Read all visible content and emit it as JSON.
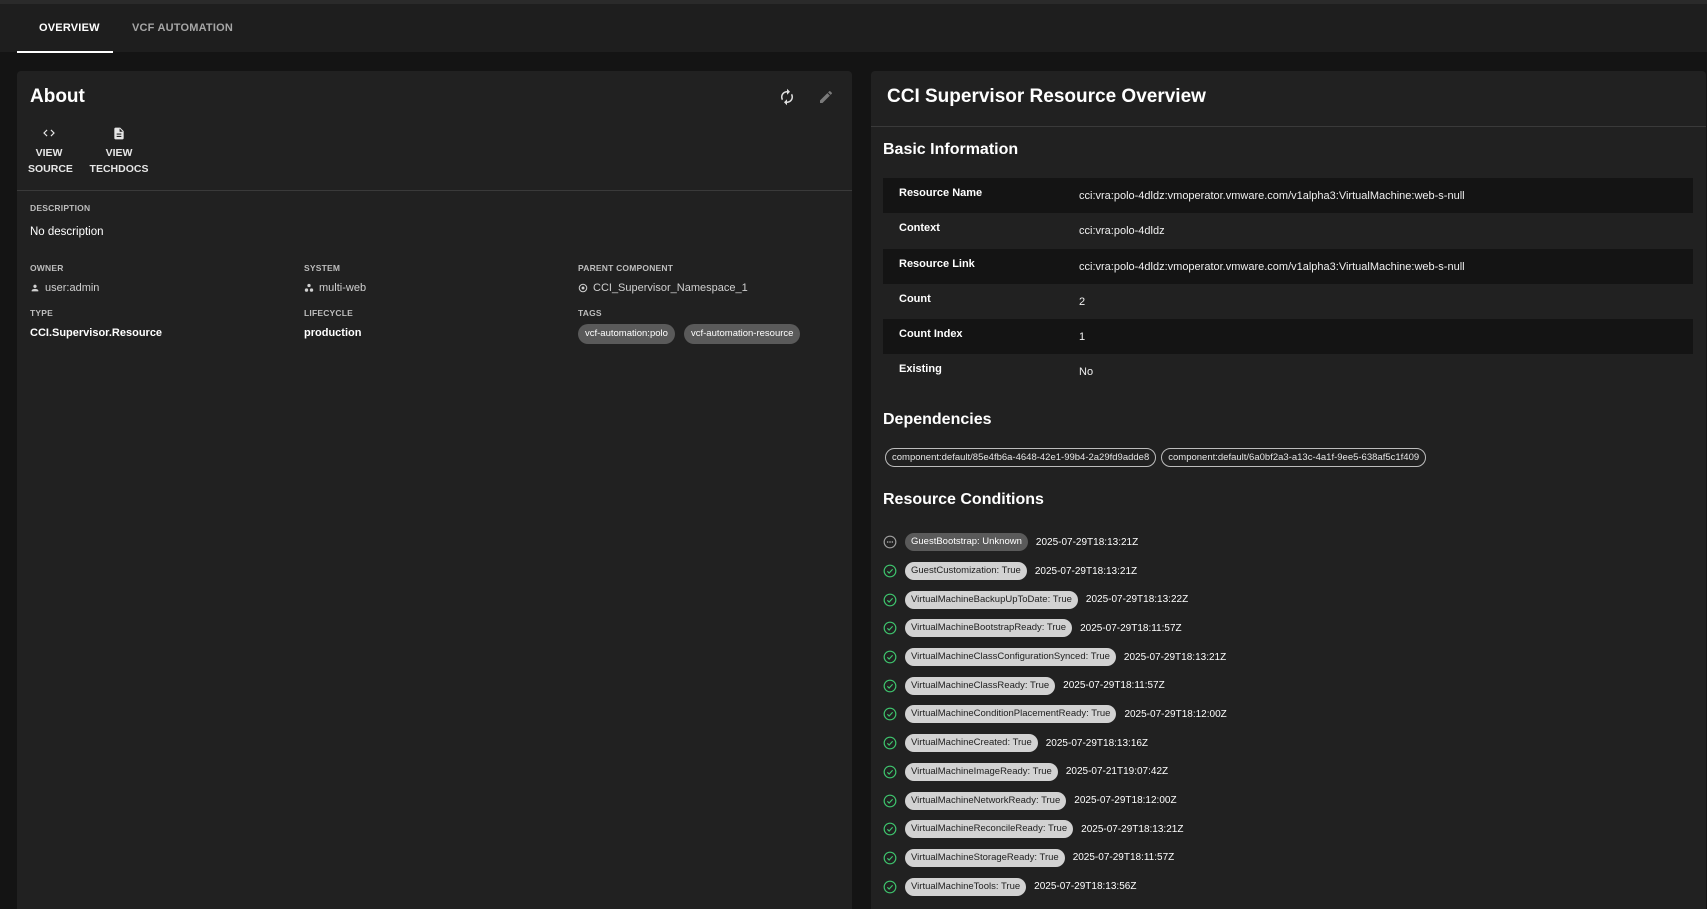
{
  "tabs": [
    {
      "label": "OVERVIEW"
    },
    {
      "label": "VCF AUTOMATION"
    }
  ],
  "about": {
    "title": "About",
    "view_source": [
      "VIEW",
      "SOURCE"
    ],
    "view_techdocs": [
      "VIEW",
      "TECHDOCS"
    ],
    "description_label": "DESCRIPTION",
    "description": "No description",
    "owner_label": "OWNER",
    "owner": "user:admin",
    "system_label": "SYSTEM",
    "system": "multi-web",
    "parent_label": "PARENT COMPONENT",
    "parent": "CCI_Supervisor_Namespace_1",
    "type_label": "TYPE",
    "type": "CCI.Supervisor.Resource",
    "lifecycle_label": "LIFECYCLE",
    "lifecycle": "production",
    "tags_label": "TAGS",
    "tags": [
      "vcf-automation:polo",
      "vcf-automation-resource"
    ]
  },
  "overview": {
    "title": "CCI Supervisor Resource Overview",
    "basic_title": "Basic Information",
    "basic_rows": [
      {
        "key": "Resource Name",
        "value": "cci:vra:polo-4dldz:vmoperator.vmware.com/v1alpha3:VirtualMachine:web-s-null"
      },
      {
        "key": "Context",
        "value": "cci:vra:polo-4dldz"
      },
      {
        "key": "Resource Link",
        "value": "cci:vra:polo-4dldz:vmoperator.vmware.com/v1alpha3:VirtualMachine:web-s-null"
      },
      {
        "key": "Count",
        "value": "2"
      },
      {
        "key": "Count Index",
        "value": "1"
      },
      {
        "key": "Existing",
        "value": "No"
      }
    ],
    "deps_title": "Dependencies",
    "dependencies": [
      "component:default/85e4fb6a-4648-42e1-99b4-2a29fd9adde8",
      "component:default/6a0bf2a3-a13c-4a1f-9ee5-638af5c1f409"
    ],
    "conditions_title": "Resource Conditions",
    "conditions": [
      {
        "label": "GuestBootstrap: Unknown",
        "time": "2025-07-29T18:13:21Z",
        "status": "unknown"
      },
      {
        "label": "GuestCustomization: True",
        "time": "2025-07-29T18:13:21Z",
        "status": "true"
      },
      {
        "label": "VirtualMachineBackupUpToDate: True",
        "time": "2025-07-29T18:13:22Z",
        "status": "true"
      },
      {
        "label": "VirtualMachineBootstrapReady: True",
        "time": "2025-07-29T18:11:57Z",
        "status": "true"
      },
      {
        "label": "VirtualMachineClassConfigurationSynced: True",
        "time": "2025-07-29T18:13:21Z",
        "status": "true"
      },
      {
        "label": "VirtualMachineClassReady: True",
        "time": "2025-07-29T18:11:57Z",
        "status": "true"
      },
      {
        "label": "VirtualMachineConditionPlacementReady: True",
        "time": "2025-07-29T18:12:00Z",
        "status": "true"
      },
      {
        "label": "VirtualMachineCreated: True",
        "time": "2025-07-29T18:13:16Z",
        "status": "true"
      },
      {
        "label": "VirtualMachineImageReady: True",
        "time": "2025-07-21T19:07:42Z",
        "status": "true"
      },
      {
        "label": "VirtualMachineNetworkReady: True",
        "time": "2025-07-29T18:12:00Z",
        "status": "true"
      },
      {
        "label": "VirtualMachineReconcileReady: True",
        "time": "2025-07-29T18:13:21Z",
        "status": "true"
      },
      {
        "label": "VirtualMachineStorageReady: True",
        "time": "2025-07-29T18:11:57Z",
        "status": "true"
      },
      {
        "label": "VirtualMachineTools: True",
        "time": "2025-07-29T18:13:56Z",
        "status": "true"
      }
    ]
  },
  "colors": {
    "success": "#3ec46d",
    "background": "#141414",
    "card": "#212121"
  }
}
